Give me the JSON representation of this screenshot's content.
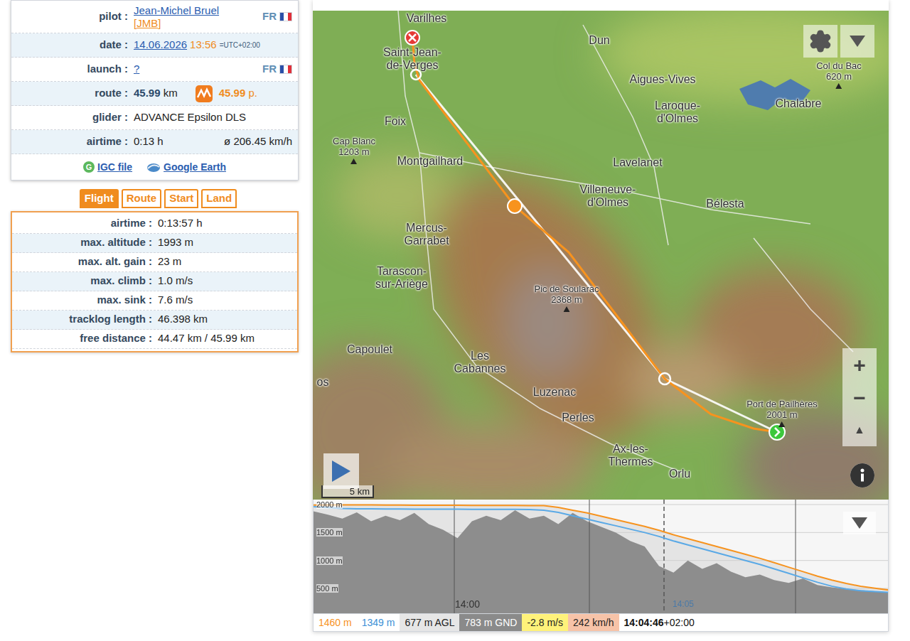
{
  "summary": {
    "pilot": {
      "label": "pilot :",
      "name": "Jean-Michel Bruel",
      "nick": "[JMB]",
      "country": "FR"
    },
    "date": {
      "label": "date :",
      "date": "14.06.2026",
      "time": "13:56",
      "tz": "=UTC+02:00"
    },
    "launch": {
      "label": "launch :",
      "value": "?",
      "country": "FR"
    },
    "route": {
      "label": "route :",
      "distance": "45.99",
      "unit": "km",
      "points": "45.99",
      "points_unit": "p."
    },
    "glider": {
      "label": "glider :",
      "value": "ADVANCE Epsilon DLS"
    },
    "airtime": {
      "label": "airtime :",
      "value": "0:13 h",
      "speed": "ø 206.45 km/h"
    },
    "links": [
      {
        "label": "IGC file",
        "badge": "G"
      },
      {
        "label": "Google Earth",
        "badge": ""
      }
    ]
  },
  "tabs": [
    {
      "label": "Flight",
      "selected": true
    },
    {
      "label": "Route",
      "selected": false
    },
    {
      "label": "Start",
      "selected": false
    },
    {
      "label": "Land",
      "selected": false
    }
  ],
  "stats": [
    {
      "label": "airtime :",
      "value": "0:13:57 h"
    },
    {
      "label": "max. altitude :",
      "value": "1993 m"
    },
    {
      "label": "max. alt. gain :",
      "value": "23 m"
    },
    {
      "label": "max. climb :",
      "value": "1.0 m/s"
    },
    {
      "label": "max. sink :",
      "value": "7.6 m/s"
    },
    {
      "label": "tracklog length :",
      "value": "46.398 km"
    },
    {
      "label": "free distance :",
      "value": "44.47 km / 45.99 km"
    }
  ],
  "map": {
    "places": [
      {
        "lines": [
          "Varilhes"
        ]
      },
      {
        "lines": [
          "Saint-Jean-",
          "de-Verges"
        ]
      },
      {
        "lines": [
          "Dun"
        ]
      },
      {
        "lines": [
          "Aigues-Vives"
        ]
      },
      {
        "lines": [
          "Laroque-",
          "d'Olmes"
        ]
      },
      {
        "lines": [
          "Chalabre"
        ]
      },
      {
        "lines": [
          "Foix"
        ]
      },
      {
        "lines": [
          "Montgailhard"
        ]
      },
      {
        "lines": [
          "Lavelanet"
        ]
      },
      {
        "lines": [
          "Villeneuve-",
          "d'Olmes"
        ]
      },
      {
        "lines": [
          "Bélesta"
        ]
      },
      {
        "lines": [
          "Mercus-",
          "Garrabet"
        ]
      },
      {
        "lines": [
          "Tarascon-",
          "sur-Ariège"
        ]
      },
      {
        "lines": [
          "Capoulet"
        ]
      },
      {
        "lines": [
          "Les",
          "Cabannes"
        ]
      },
      {
        "lines": [
          "Luzenac"
        ]
      },
      {
        "lines": [
          "Perles"
        ]
      },
      {
        "lines": [
          "Ax-les-",
          "Thermes"
        ]
      },
      {
        "lines": [
          "Orlu"
        ]
      },
      {
        "lines": [
          "os"
        ]
      }
    ],
    "peaks": [
      {
        "name": "Cap Blanc",
        "elevation": "1203 m"
      },
      {
        "name": "Pic de Soularac",
        "elevation": "2368 m"
      },
      {
        "name": "Port de Pailhères",
        "elevation": "2001 m"
      },
      {
        "name": "Col du Bac",
        "elevation": "620 m"
      }
    ],
    "controls": {
      "zoom_in": "+",
      "zoom_out": "−",
      "north": "▲"
    },
    "scale": "5 km"
  },
  "chart": {
    "y_ticks": [
      "2000 m",
      "1500 m",
      "1000 m",
      "500 m"
    ],
    "time_ticks": [
      "14:00",
      "14:05"
    ],
    "series": [
      {
        "name": "altitude",
        "color": "#f7931e",
        "values": [
          1990,
          1992,
          1993,
          1993,
          1992,
          1990,
          1990,
          1988,
          1988,
          1987,
          1986,
          1985,
          1985,
          1984,
          1983,
          1982,
          1980,
          1950,
          1900,
          1850,
          1790,
          1730,
          1670,
          1610,
          1540,
          1460,
          1390,
          1320,
          1250,
          1180,
          1110,
          1040,
          960,
          880,
          800,
          720,
          650,
          590,
          540,
          505,
          470
        ]
      },
      {
        "name": "gps altitude",
        "color": "#5aa9e6",
        "values": [
          1960,
          1945,
          1930,
          1925,
          1925,
          1920,
          1920,
          1918,
          1918,
          1917,
          1916,
          1915,
          1915,
          1914,
          1913,
          1912,
          1900,
          1860,
          1800,
          1740,
          1680,
          1620,
          1560,
          1500,
          1430,
          1349,
          1280,
          1210,
          1140,
          1070,
          1000,
          930,
          850,
          770,
          690,
          610,
          540,
          490,
          460,
          445,
          430
        ]
      }
    ],
    "ground": [
      1880,
      1820,
      1750,
      1860,
      1700,
      1800,
      1720,
      1850,
      1650,
      1550,
      1400,
      1700,
      1800,
      1720,
      1900,
      1750,
      1800,
      1650,
      1850,
      1700,
      1600,
      1500,
      1350,
      1250,
      900,
      783,
      1000,
      850,
      950,
      800,
      700,
      750,
      650,
      600,
      680,
      560,
      520,
      490,
      470,
      450,
      430
    ]
  },
  "status": [
    {
      "text": "1460 m",
      "color": "#f7931e",
      "background": "#ffffff",
      "bold": false
    },
    {
      "text": "1349 m",
      "color": "#3b8fd6",
      "background": "#ffffff",
      "bold": false
    },
    {
      "text": "677 m AGL",
      "color": "#222222",
      "background": "#e6e6e6",
      "bold": false
    },
    {
      "text": "783 m GND",
      "color": "#ffffff",
      "background": "#8a8a8a",
      "bold": false
    },
    {
      "text": "-2.8 m/s",
      "color": "#222222",
      "background": "#fff27a",
      "bold": false
    },
    {
      "text": "242 km/h",
      "color": "#222222",
      "background": "#f7c3a8",
      "bold": false
    },
    {
      "text": "14:04:46",
      "color": "#111111",
      "background": "#ffffff",
      "bold": true,
      "suffix": "+02:00"
    }
  ]
}
